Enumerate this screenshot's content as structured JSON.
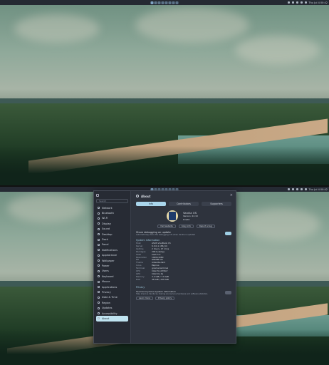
{
  "panel": {
    "workspaces": [
      "1",
      "2",
      "3",
      "4",
      "5",
      "6",
      "7",
      "8"
    ],
    "clock": "Thu Jul 4 00:42"
  },
  "settings": {
    "window_title": "About",
    "search_placeholder": "Search",
    "nav": [
      {
        "label": "Network",
        "icon": "network-icon"
      },
      {
        "label": "Bluetooth",
        "icon": "bluetooth-icon"
      },
      {
        "label": "Wi-Fi",
        "icon": "wifi-icon"
      },
      {
        "label": "Display",
        "icon": "display-icon"
      },
      {
        "label": "Sound",
        "icon": "sound-icon"
      },
      {
        "label": "Desktop",
        "icon": "desktop-icon"
      },
      {
        "label": "Dock",
        "icon": "dock-icon"
      },
      {
        "label": "Panel",
        "icon": "panel-icon"
      },
      {
        "label": "Notifications",
        "icon": "bell-icon"
      },
      {
        "label": "Appearance",
        "icon": "palette-icon"
      },
      {
        "label": "Wallpaper",
        "icon": "image-icon"
      },
      {
        "label": "Power",
        "icon": "power-icon"
      },
      {
        "label": "Users",
        "icon": "user-icon"
      },
      {
        "label": "Keyboard",
        "icon": "keyboard-icon"
      },
      {
        "label": "Mouse",
        "icon": "mouse-icon"
      },
      {
        "label": "Applications",
        "icon": "apps-icon"
      },
      {
        "label": "Privacy",
        "icon": "shield-icon"
      },
      {
        "label": "Date & Time",
        "icon": "clock-icon"
      },
      {
        "label": "Region",
        "icon": "globe-icon"
      },
      {
        "label": "Updates",
        "icon": "update-icon"
      },
      {
        "label": "Accessibility",
        "icon": "accessibility-icon"
      },
      {
        "label": "About",
        "icon": "info-icon"
      }
    ],
    "tabs": [
      "Info",
      "Contributors",
      "Supporters"
    ],
    "distro_name": "Vanilla OS",
    "version": "Version: 22.10",
    "codename": "Kinetic",
    "buttons": [
      "Visit website",
      "Copy info",
      "Report a bug"
    ],
    "share_title": "Share debugging on update",
    "share_sub": "Automatically share the debugging info when Vanilla is updated",
    "system_heading": "System Information",
    "system_info": [
      [
        "Host",
        "ASUS VivoBook 15"
      ],
      [
        "Kernel",
        "6.0.0-1 x86_64"
      ],
      [
        "Uptime",
        "2 hours, 17 mins"
      ],
      [
        "Packages",
        "2041 (dpkg)"
      ],
      [
        "Shell",
        "bash 5.2"
      ],
      [
        "Resolution",
        "1920x1080"
      ],
      [
        "DE",
        "GNOME 43"
      ],
      [
        "Theme",
        "Adwaita-dark"
      ],
      [
        "Icons",
        "Papirus"
      ],
      [
        "Terminal",
        "gnome-terminal"
      ],
      [
        "CPU",
        "Intel i5-1135G7"
      ],
      [
        "GPU",
        "Intel Iris Xe"
      ],
      [
        "Memory",
        "3.2 GiB / 7.6 GiB"
      ],
      [
        "Disk",
        "48 GiB / 238 GiB"
      ]
    ],
    "privacy_heading": "Privacy",
    "privacy_title": "Send anonymous system information",
    "privacy_sub": "Help improve Vanilla by sharing anonymous hardware and software statistics.",
    "privacy_buttons": [
      "Learn more",
      "Privacy policy"
    ]
  },
  "colors": {
    "accent": "#a9d6ec",
    "window": "#2e333d",
    "sidebar": "#272b34"
  }
}
